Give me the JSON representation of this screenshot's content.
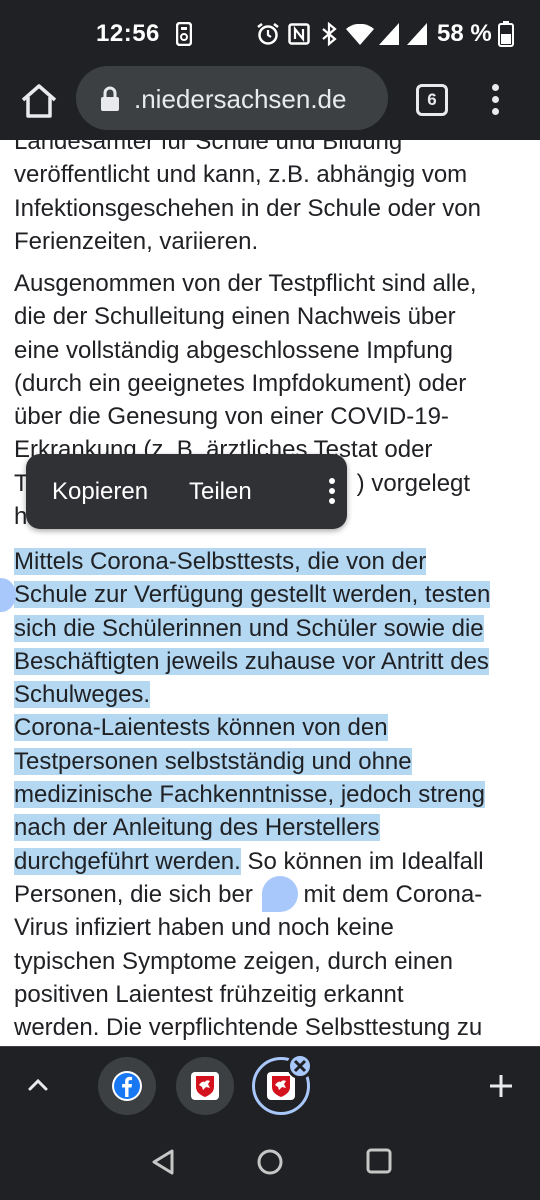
{
  "status_bar": {
    "time": "12:56",
    "battery_percent": "58 %"
  },
  "toolbar": {
    "url": ".niedersachsen.de",
    "tab_count": "6"
  },
  "content": {
    "paragraph1": [
      "Landesamter für Schule und Bildung",
      "veröffentlicht und kann, z.B. abhängig vom",
      "Infektionsgeschehen in der Schule oder von",
      "Ferienzeiten, variieren."
    ],
    "paragraph2": [
      "Ausgenommen von der Testpflicht sind alle,",
      "die der Schulleitung einen Nachweis über",
      "eine vollständig abgeschlossene Impfung",
      "(durch ein geeignetes Impfdokument) oder",
      "über die Genesung von einer COVID-19-",
      "Erkrankung (z. B. ärztliches Testat oder",
      ") vorgelegt",
      "h"
    ],
    "paragraph2_line7_lead": "T",
    "paragraph3_selected": [
      "Mittels Corona-Selbsttests, die von der",
      "Schule zur Verfügung gestellt werden, testen",
      "sich die Schülerinnen und Schüler sowie die",
      "Beschäftigten jeweils zuhause vor Antritt des",
      "Schulweges.",
      "Corona-Laientests können von den",
      "Testpersonen selbstständig und ohne",
      "medizinische Fachkenntnisse, jedoch streng",
      "nach der Anleitung des Herstellers",
      "durchgeführt werden."
    ],
    "paragraph3_rest": [
      " So können im Idealfall",
      "Personen, die sich ber",
      "s mit dem Corona-",
      "Virus infiziert haben und noch keine",
      "typischen Symptome zeigen, durch einen",
      "positiven Laientest frühzeitig erkannt",
      "werden. Die verpflichtende Selbsttestung zu"
    ]
  },
  "context_menu": {
    "copy_label": "Kopieren",
    "share_label": "Teilen"
  },
  "tab_strip": {
    "tabs": [
      "facebook-favicon",
      "niedersachsen-favicon",
      "niedersachsen-favicon-active"
    ]
  },
  "colors": {
    "selection": "#b4d8f2",
    "bars": "#202124",
    "accent": "#a8c7fa"
  }
}
